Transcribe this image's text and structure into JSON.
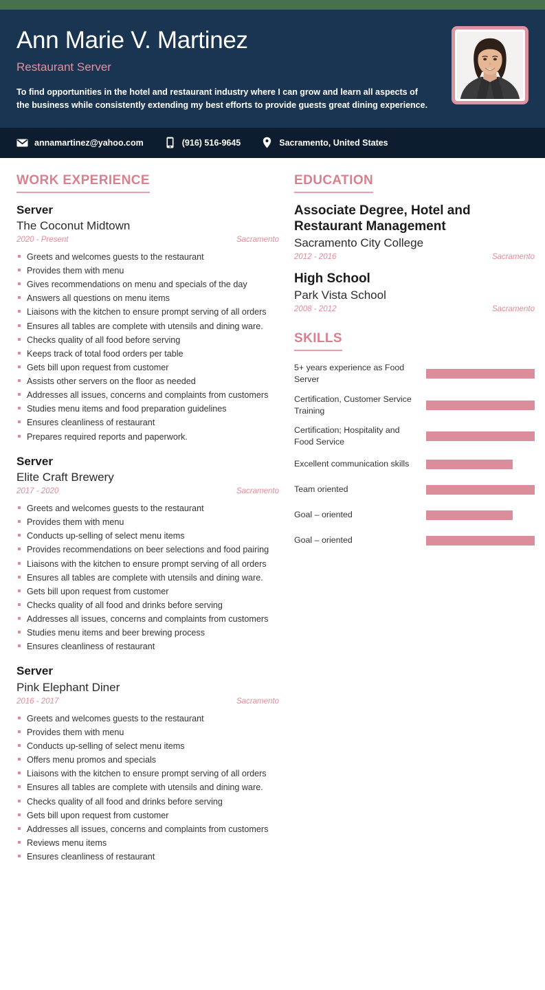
{
  "theme": {
    "accent_pink": "#DE93A0",
    "bar_pink": "#DB8D9B",
    "header_navy": "#1A3551",
    "contact_navy": "#0D1C2E",
    "top_strip_green": "#47704F"
  },
  "header": {
    "name": "Ann Marie V. Martinez",
    "job_title": "Restaurant Server",
    "summary": "To find opportunities in the hotel and restaurant industry where I can grow and learn all aspects of the business while consistently extending my best efforts to provide guests great dining experience.",
    "photo_alt": "profile-photo"
  },
  "contact": [
    {
      "icon": "envelope-icon",
      "value": "annamartinez@yahoo.com"
    },
    {
      "icon": "phone-icon",
      "value": "(916) 516-9645"
    },
    {
      "icon": "location-pin-icon",
      "value": "Sacramento, United States"
    }
  ],
  "work_experience": {
    "title": "WORK EXPERIENCE",
    "entries": [
      {
        "role": "Server",
        "organization": "The Coconut Midtown",
        "dates": "2020 - Present",
        "location": "Sacramento",
        "bullets": [
          "Greets and welcomes guests to the restaurant",
          "Provides them with menu",
          "Gives recommendations on menu and specials of the day",
          "Answers all questions on menu items",
          "Liaisons with the kitchen to ensure prompt serving of all orders",
          "Ensures all tables are complete with utensils and dining ware.",
          "Checks quality of all food before serving",
          "Keeps track of total food orders per table",
          "Gets bill upon request from customer",
          "Assists other servers on the floor as needed",
          "Addresses all issues, concerns and complaints from customers",
          "Studies menu items and food preparation guidelines",
          "Ensures cleanliness of restaurant",
          "Prepares required reports and paperwork."
        ]
      },
      {
        "role": "Server",
        "organization": "Elite Craft Brewery",
        "dates": "2017 - 2020",
        "location": "Sacramento",
        "bullets": [
          "Greets and welcomes guests to the restaurant",
          "Provides them with menu",
          "Conducts up-selling of select menu items",
          "Provides recommendations on beer selections and food pairing",
          "Liaisons with the kitchen to ensure prompt serving of all orders",
          "Ensures all tables are complete with utensils and dining ware.",
          "Gets bill upon request from customer",
          "Checks quality of all food and drinks before serving",
          "Addresses all issues, concerns and complaints from customers",
          "Studies menu items and beer brewing process",
          "Ensures cleanliness of restaurant"
        ]
      },
      {
        "role": "Server",
        "organization": "Pink Elephant Diner",
        "dates": "2016 - 2017",
        "location": "Sacramento",
        "bullets": [
          "Greets and welcomes guests to the restaurant",
          "Provides them with menu",
          "Conducts up-selling of select menu items",
          "Offers menu promos and specials",
          "Liaisons with the kitchen to ensure prompt serving of all orders",
          "Ensures all tables are complete with utensils and dining ware.",
          "Checks quality of all food and drinks before serving",
          "Gets bill upon request from customer",
          "Addresses all issues, concerns and complaints from customers",
          "Reviews menu items",
          "Ensures cleanliness of restaurant"
        ]
      }
    ]
  },
  "education": {
    "title": "EDUCATION",
    "entries": [
      {
        "degree": "Associate Degree, Hotel and Restaurant Management",
        "school": "Sacramento City College",
        "dates": "2012 - 2016",
        "location": "Sacramento"
      },
      {
        "degree": "High School",
        "school": "Park Vista School",
        "dates": "2008 - 2012",
        "location": "Sacramento"
      }
    ]
  },
  "skills": {
    "title": "SKILLS",
    "items": [
      {
        "label": "5+ years experience as Food Server",
        "level": 100
      },
      {
        "label": "Certification, Customer Service Training",
        "level": 100
      },
      {
        "label": "Certification; Hospitality and Food Service",
        "level": 100
      },
      {
        "label": "Excellent communication skills",
        "level": 80
      },
      {
        "label": "Team oriented",
        "level": 100
      },
      {
        "label": "Goal – oriented",
        "level": 80
      },
      {
        "label": "Goal – oriented",
        "level": 100
      }
    ]
  }
}
